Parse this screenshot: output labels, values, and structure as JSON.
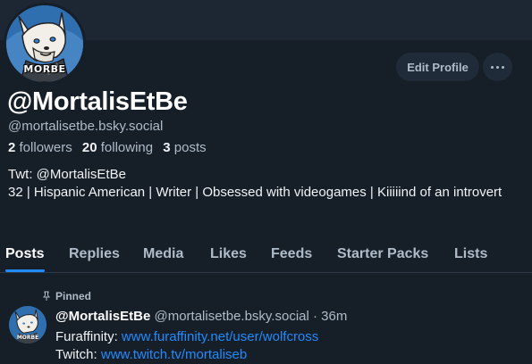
{
  "profile": {
    "display_name": "@MortalisEtBe",
    "handle": "@mortalisetbe.bsky.social",
    "avatar_text": "MORBE",
    "followers_count": "2",
    "followers_label": "followers",
    "following_count": "20",
    "following_label": "following",
    "posts_count": "3",
    "posts_label": "posts",
    "bio_line1": "Twt: @MortalisEtBe",
    "bio_line2": "32 | Hispanic American | Writer | Obsessed with videogames | Kiiiiind of an introvert"
  },
  "actions": {
    "edit_profile": "Edit Profile",
    "more_icon": "ellipsis-icon"
  },
  "tabs": [
    {
      "label": "Posts",
      "active": true
    },
    {
      "label": "Replies"
    },
    {
      "label": "Media"
    },
    {
      "label": "Likes"
    },
    {
      "label": "Feeds"
    },
    {
      "label": "Starter Packs"
    },
    {
      "label": "Lists"
    }
  ],
  "post": {
    "pinned_label": "Pinned",
    "author_name": "@MortalisEtBe",
    "author_handle": "@mortalisetbe.bsky.social",
    "separator": "·",
    "time": "36m",
    "line1_prefix": "Furaffinity: ",
    "line1_link": "www.furaffinity.net/user/wolfcross",
    "line2_prefix": "Twitch: ",
    "line2_link": "www.twitch.tv/mortaliseb"
  },
  "colors": {
    "background": "#161e27",
    "accent": "#208bfe",
    "muted_text": "#aebbc9"
  }
}
